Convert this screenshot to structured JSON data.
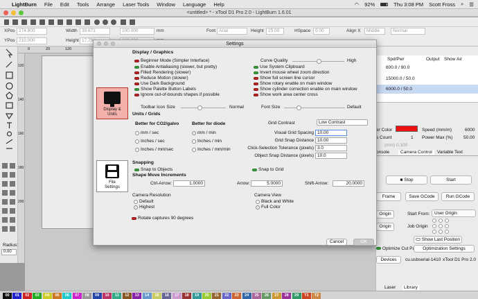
{
  "menubar": {
    "app": "LightBurn",
    "items": [
      "File",
      "Edit",
      "Tools",
      "Arrange",
      "Laser Tools",
      "Window",
      "Language",
      "Help"
    ],
    "battery": "92%",
    "time": "Thu 3:08 PM",
    "user": "Scott Fross"
  },
  "window": {
    "title": "<untitled> * - xTool D1 Pro 2.0 - LightBurn 1.6.01"
  },
  "toolbar": {
    "xpos_label": "XPos",
    "xpos": "174.800",
    "ypos_label": "YPos",
    "ypos": "210.000",
    "width_label": "Width",
    "width": "39.671",
    "height_label": "Height",
    "height": "17.793",
    "scale_w": "100.000",
    "scale_h": "100.000",
    "unit": "mm",
    "font_label": "Font",
    "font": "Arial",
    "fheight_label": "Height",
    "fheight": "25.00",
    "hspace_label": "HSpace",
    "hspace": "0.00",
    "alignx_label": "Align X",
    "alignx": "Middle",
    "normal": "Normal",
    "vspace_label": "VSpace",
    "vspace": "0.00",
    "aligny_label": "Align Y",
    "aligny": "Middle",
    "offset_label": "Offset",
    "offset": "0",
    "bold": "Bold",
    "italic": "Italic",
    "upper": "Upper Case",
    "welded": "Welded",
    "distort": "Distort",
    "align_y_label": "Align Y",
    "text_label": "Text"
  },
  "rulers": {
    "top": [
      "0",
      "20",
      "40",
      "60",
      "80",
      "100",
      "120"
    ],
    "top_show": [
      "0",
      "20",
      "120"
    ],
    "left": [
      "120",
      "140",
      "160",
      "180",
      "200"
    ]
  },
  "left_tools": {
    "radius_label": "Radius:",
    "radius": "0.00"
  },
  "right_panel": {
    "headers": [
      "Spd/Pwr",
      "Output",
      "Show",
      "Air"
    ],
    "rows": [
      "600.0 / 90.0",
      "15000.0 / 50.0",
      "6000.0 / 50.0"
    ],
    "color_label": "er Color",
    "speed_label": "Speed (mm/m)",
    "speed": "6000",
    "count_label": "s Count",
    "count": "1",
    "power_label": "Power Max (%)",
    "power": "50.00",
    "interval": "(mm)   0.100",
    "tabs": [
      "onsole",
      "Camera Control",
      "Variable Text"
    ],
    "stop": "Stop",
    "start": "Start",
    "frame": "Frame",
    "save_gcode": "Save GCode",
    "run_gcode": "Run GCode",
    "origin": "Origin",
    "start_from_label": "Start From:",
    "start_from": "User Origin",
    "job_origin_label": "Job Origin",
    "origin2": "Origin",
    "show_last": "Show Last Position",
    "optimize_cut": "Optimize Cut Path",
    "opt_settings": "Optimization Settings",
    "devices": "Devices",
    "port": "cu.usbserial-1410",
    "device": "xTool D1 Pro 2.0",
    "bottom_tabs": [
      "Laser",
      "Library"
    ]
  },
  "palette": {
    "labels": [
      "00",
      "01",
      "02",
      "03",
      "04",
      "05",
      "06",
      "07",
      "08",
      "09",
      "10",
      "11",
      "12",
      "13",
      "14",
      "15",
      "16",
      "17",
      "18",
      "19",
      "20",
      "21",
      "22",
      "23",
      "24",
      "25",
      "26",
      "27",
      "28",
      "29",
      "T1",
      "T2"
    ],
    "colors": [
      "#111111",
      "#2222cc",
      "#cc2222",
      "#22aa22",
      "#cccc22",
      "#cc7722",
      "#22cccc",
      "#cc22cc",
      "#999999",
      "#2244aa",
      "#bb3366",
      "#33aa88",
      "#885522",
      "#8822aa",
      "#6699cc",
      "#cccc66",
      "#666699",
      "#cc99cc",
      "#993333",
      "#339999",
      "#99cc33",
      "#996633",
      "#6666cc",
      "#cc6633",
      "#3366aa",
      "#aa6699",
      "#669966",
      "#cc9933",
      "#993399",
      "#339966",
      "#cc4422",
      "#cc8844"
    ]
  },
  "dialog": {
    "title": "Settings",
    "categories": [
      {
        "label1": "Display &",
        "label2": "Units"
      },
      {
        "label1": "File",
        "label2": "Settings"
      }
    ],
    "display_graphics": "Display / Graphics",
    "left_opts": [
      {
        "label": "Beginner Mode (Simpler Interface)",
        "state": "red"
      },
      {
        "label": "Enable Antialiasing (slower, but pretty)",
        "state": "on"
      },
      {
        "label": "Filled Rendering (slower)",
        "state": "red"
      },
      {
        "label": "Reduce Motion (slower)",
        "state": "red"
      },
      {
        "label": "Use Dark Background",
        "state": "red"
      },
      {
        "label": "Show Palette Button Labels",
        "state": "on"
      },
      {
        "label": "Ignore out-of-bounds shapes if possible",
        "state": "red"
      }
    ],
    "curve_quality": "Curve Quality",
    "curve_high": "High",
    "right_opts": [
      {
        "label": "Use System Clipboard",
        "state": "on"
      },
      {
        "label": "Invert mouse wheel zoom direction",
        "state": "on"
      },
      {
        "label": "Show full screen line cursor",
        "state": "red"
      },
      {
        "label": "Show rotary enable on main window",
        "state": "red"
      },
      {
        "label": "Show cylinder correction enable on main window",
        "state": "red"
      },
      {
        "label": "Show work area center cross",
        "state": "red"
      }
    ],
    "toolbar_icon_size": "Toolbar Icon Size",
    "normal": "Normal",
    "font_size": "Font Size",
    "default": "Default",
    "units_grids": "Units / Grids",
    "co2_title": "Better for CO2/galvo",
    "co2_opts": [
      "mm / sec",
      "Inches / sec",
      "Inches / mm/sec"
    ],
    "diode_title": "Better for diode",
    "diode_opts": [
      "mm / min",
      "Inches / min",
      "Inches / mm/min"
    ],
    "grid_contrast": "Grid Contrast",
    "grid_contrast_val": "Low Contrast",
    "grid_fields": [
      {
        "label": "Visual Grid Spacing",
        "value": "10.00"
      },
      {
        "label": "Grid Snap Distance",
        "value": "10.00"
      },
      {
        "label": "Click-Selection Tolerance (pixels)",
        "value": "3.0"
      },
      {
        "label": "Object Snap Distance (pixels)",
        "value": "10.0"
      }
    ],
    "snapping": "Snapping",
    "snap_objects": "Snap to Objects",
    "snap_grid": "Snap to Grid",
    "shape_move": "Shape Move Increments",
    "ctrl_arrow": "Ctrl-Arrow:",
    "ctrl_val": "1.0000",
    "arrow": "Arrow:",
    "arrow_val": "5.0000",
    "shift_arrow": "Shift-Arrow:",
    "shift_val": "20.0000",
    "cam_res": "Camera Resolution",
    "cam_default": "Default",
    "cam_highest": "Highest",
    "cam_view": "Camera View",
    "cam_bw": "Black and White",
    "cam_full": "Full Color",
    "rotate": "Rotate captures 90 degrees",
    "cancel": "Cancel",
    "ok": "OK"
  }
}
